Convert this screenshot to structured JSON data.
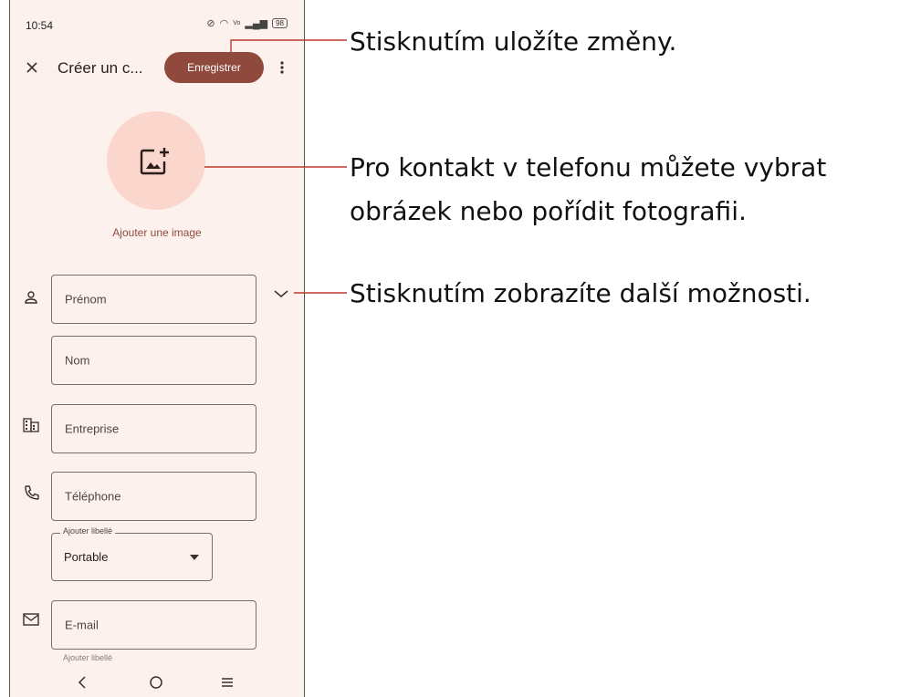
{
  "status_bar": {
    "time": "10:54",
    "battery": "98"
  },
  "app_bar": {
    "title": "Créer un c...",
    "save_label": "Enregistrer"
  },
  "avatar": {
    "add_image_label": "Ajouter une image"
  },
  "fields": {
    "first_name": "Prénom",
    "last_name": "Nom",
    "company": "Entreprise",
    "phone": "Téléphone",
    "phone_label_legend": "Ajouter libellé",
    "phone_label_value": "Portable",
    "email": "E-mail",
    "email_label_legend_cut": "Ajouter libellé"
  },
  "callouts": {
    "save": "Stisknutím uložíte změny.",
    "photo_line1": "Pro kontakt v telefonu můžete vybrat",
    "photo_line2": "obrázek nebo pořídit fotografii.",
    "more": "Stisknutím zobrazíte další možnosti."
  },
  "colors": {
    "accent": "#8f4a3d",
    "background": "#fdf1ee",
    "avatar_bg": "#fbd6cd",
    "callout_line": "#c0392b"
  }
}
